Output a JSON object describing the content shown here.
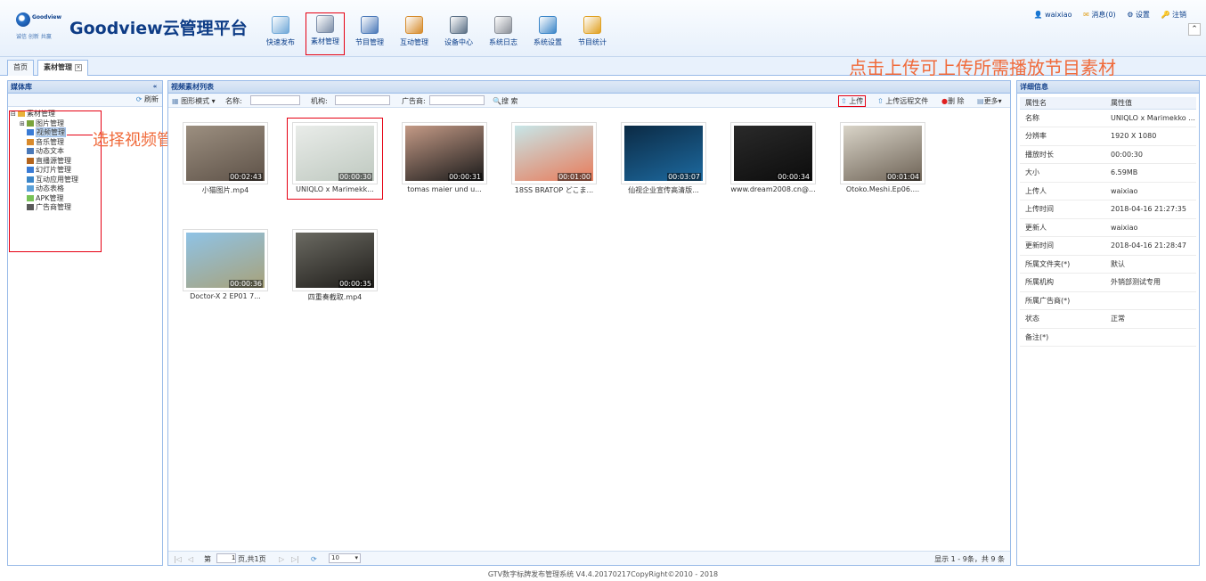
{
  "header": {
    "logo_brand": "Goodview",
    "logo_sub": "诚信 创新 共赢",
    "title": "Goodview云管理平台",
    "nav": [
      {
        "label": "快速发布",
        "icon": "quick-publish-icon",
        "color": "#6fa8d8"
      },
      {
        "label": "素材管理",
        "icon": "material-icon",
        "color": "#7b8da8"
      },
      {
        "label": "节目管理",
        "icon": "program-icon",
        "color": "#4a78b8"
      },
      {
        "label": "互动管理",
        "icon": "interactive-icon",
        "color": "#d58a2a"
      },
      {
        "label": "设备中心",
        "icon": "device-icon",
        "color": "#5a6f85"
      },
      {
        "label": "系统日志",
        "icon": "log-icon",
        "color": "#8a8f98"
      },
      {
        "label": "系统设置",
        "icon": "settings-icon",
        "color": "#3a85c8"
      },
      {
        "label": "节目统计",
        "icon": "stats-icon",
        "color": "#e0a020"
      }
    ],
    "user": "waixiao",
    "messages": "消息(0)",
    "settings": "设置",
    "logout": "注销"
  },
  "tabs": [
    {
      "label": "首页"
    },
    {
      "label": "素材管理",
      "active": true
    }
  ],
  "annotations": {
    "upload": "点击上传可上传所需播放节目素材",
    "select": "选择视频管理"
  },
  "left_panel": {
    "title": "媒体库",
    "refresh": "刷新",
    "tree": [
      {
        "label": "素材管理",
        "icon": "folder-icon",
        "indent": 0
      },
      {
        "label": "图片管理",
        "icon": "image-icon",
        "indent": 1
      },
      {
        "label": "视频管理",
        "icon": "video-icon",
        "indent": 1,
        "selected": true
      },
      {
        "label": "音乐管理",
        "icon": "music-icon",
        "indent": 1
      },
      {
        "label": "动态文本",
        "icon": "text-icon",
        "indent": 1
      },
      {
        "label": "直播源管理",
        "icon": "live-icon",
        "indent": 1
      },
      {
        "label": "幻灯片管理",
        "icon": "slides-icon",
        "indent": 1
      },
      {
        "label": "互动应用管理",
        "icon": "app-icon",
        "indent": 1
      },
      {
        "label": "动态表格",
        "icon": "table-icon",
        "indent": 1
      },
      {
        "label": "APK管理",
        "icon": "android-icon",
        "indent": 1
      },
      {
        "label": "广告商管理",
        "icon": "advertiser-icon",
        "indent": 1
      }
    ]
  },
  "center_panel": {
    "title": "视频素材列表",
    "view_mode": "图形模式",
    "name_label": "名称:",
    "org_label": "机构:",
    "advertiser_label": "广告商:",
    "search": "搜 索",
    "upload": "上传",
    "upload_remote": "上传远程文件",
    "delete": "删 除",
    "more": "更多",
    "items": [
      {
        "name": "小猫图片.mp4",
        "duration": "00:02:43",
        "colors": [
          "#9c8f80",
          "#5e5248"
        ]
      },
      {
        "name": "UNIQLO x Marimekk...",
        "duration": "00:00:30",
        "colors": [
          "#e9ece9",
          "#bfc9c0"
        ],
        "selected": true
      },
      {
        "name": "tomas maier und u...",
        "duration": "00:00:31",
        "colors": [
          "#c49a86",
          "#1a1a1a"
        ]
      },
      {
        "name": "18SS BRATOP どこま...",
        "duration": "00:01:00",
        "colors": [
          "#c7e6e8",
          "#e87b5a"
        ]
      },
      {
        "name": "仙视企业宣传高清版...",
        "duration": "00:03:07",
        "colors": [
          "#0b2a44",
          "#1d6aa0"
        ]
      },
      {
        "name": "www.dream2008.cn@...",
        "duration": "00:00:34",
        "colors": [
          "#2a2a2a",
          "#0c0c0c"
        ]
      },
      {
        "name": "Otoko.Meshi.Ep06....",
        "duration": "00:01:04",
        "colors": [
          "#d9d4c8",
          "#6e6356"
        ]
      },
      {
        "name": "Doctor-X 2 EP01 7...",
        "duration": "00:00:36",
        "colors": [
          "#8fc3e6",
          "#a8a27a"
        ]
      },
      {
        "name": "四重奏截取.mp4",
        "duration": "00:00:35",
        "colors": [
          "#6b6a62",
          "#1f1d1a"
        ]
      }
    ],
    "pager": {
      "page_prefix": "第",
      "page": "1",
      "page_suffix": "页,共1页",
      "page_size": "10",
      "summary": "显示 1 - 9条，共 9 条"
    }
  },
  "right_panel": {
    "title": "详细信息",
    "col_name": "属性名",
    "col_value": "属性值",
    "rows": [
      {
        "k": "名称",
        "v": "UNIQLO x Marimekko ..."
      },
      {
        "k": "分辨率",
        "v": "1920 X 1080"
      },
      {
        "k": "播放时长",
        "v": "00:00:30"
      },
      {
        "k": "大小",
        "v": "6.59MB"
      },
      {
        "k": "上传人",
        "v": "waixiao"
      },
      {
        "k": "上传时间",
        "v": "2018-04-16 21:27:35"
      },
      {
        "k": "更新人",
        "v": "waixiao"
      },
      {
        "k": "更新时间",
        "v": "2018-04-16 21:28:47"
      },
      {
        "k": "所属文件夹(*)",
        "v": "默认"
      },
      {
        "k": "所属机构",
        "v": "外销部测试专用"
      },
      {
        "k": "所属广告商(*)",
        "v": ""
      },
      {
        "k": "状态",
        "v": "正常"
      },
      {
        "k": "备注(*)",
        "v": ""
      }
    ]
  },
  "footer": "GTV数字标牌发布管理系统 V4.4.20170217CopyRight©2010 - 2018"
}
